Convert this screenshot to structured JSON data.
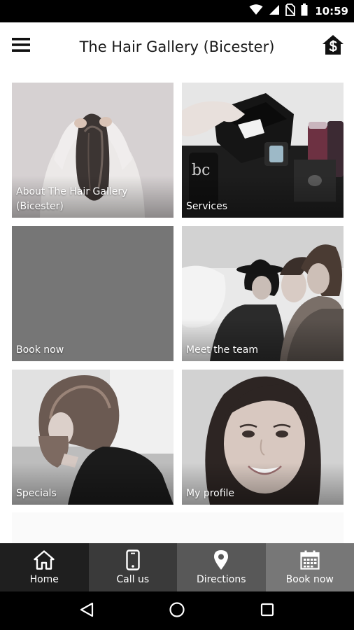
{
  "status_bar": {
    "time": "10:59",
    "icons": [
      "wifi-icon",
      "cell-signal-icon",
      "no-sim-icon",
      "battery-icon"
    ]
  },
  "header": {
    "title": "The Hair Gallery (Bicester)",
    "menu_icon": "hamburger-menu-icon",
    "switch_icon": "home-dollar-icon"
  },
  "tiles": [
    {
      "label": "About The Hair Gallery (Bicester)",
      "image": "woman-back-hands-in-hair"
    },
    {
      "label": "Services",
      "image": "hair-products-box"
    },
    {
      "label": "Book now",
      "image": "",
      "color": "#757575"
    },
    {
      "label": "Meet the team",
      "image": "group-of-women"
    },
    {
      "label": "Specials",
      "image": "bob-haircut-profile"
    },
    {
      "label": "My profile",
      "image": "smiling-woman-portrait"
    }
  ],
  "tabs": [
    {
      "label": "Home",
      "icon": "home-icon",
      "color": "#1f1f1f"
    },
    {
      "label": "Call us",
      "icon": "phone-icon",
      "color": "#3a3a3a"
    },
    {
      "label": "Directions",
      "icon": "map-pin-icon",
      "color": "#585858"
    },
    {
      "label": "Book now",
      "icon": "calendar-icon",
      "color": "#777777"
    }
  ],
  "nav_bar": {
    "icons": [
      "back-icon",
      "home-circle-icon",
      "recents-icon"
    ]
  }
}
